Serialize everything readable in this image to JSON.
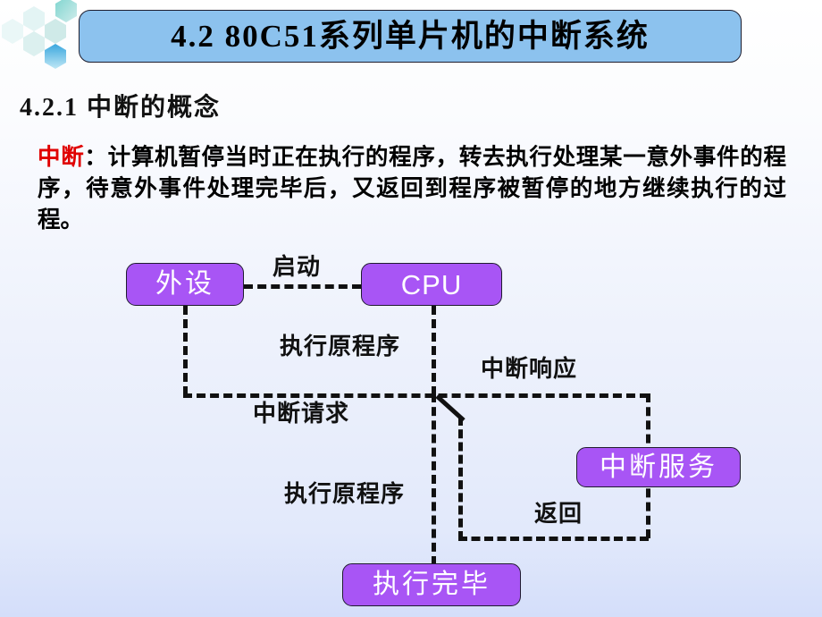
{
  "slide": {
    "background_top": "#ffffff",
    "background_bottom": "#d4defa"
  },
  "decoration": {
    "hexagon_cluster_name": "hexagon-cluster",
    "hex_colors": [
      "#e6f5f5",
      "#d8f0f0",
      "#c3e8e6",
      "#9fdcd6",
      "#6fc9d8",
      "#3aa7de"
    ]
  },
  "title": {
    "text": "4.2  80C51系列单片机的中断系统",
    "fill": "#8cc2ee",
    "border": "#1d1d2e"
  },
  "heading": {
    "text": "4.2.1 中断的概念"
  },
  "paragraph": {
    "keyword": "中断",
    "keyword_color": "#e00000",
    "colon": "：",
    "body": "计算机暂停当时正在执行的程序，转去执行处理某一意外事件的程序，待意外事件处理完毕后，又返回到程序被暂停的地方继续执行的过程。"
  },
  "diagram": {
    "node_fill": "#a855f5",
    "node_text_color": "#ffffff",
    "line_color": "#111111",
    "nodes": [
      {
        "id": "waishe",
        "label": "外设"
      },
      {
        "id": "cpu",
        "label": "CPU"
      },
      {
        "id": "service",
        "label": "中断服务"
      },
      {
        "id": "finish",
        "label": "执行完毕"
      }
    ],
    "edge_labels": [
      {
        "id": "qidong",
        "label": "启动"
      },
      {
        "id": "exec-orig-1",
        "label": "执行原程序"
      },
      {
        "id": "zhongduan-request",
        "label": "中断请求"
      },
      {
        "id": "zhongduan-response",
        "label": "中断响应"
      },
      {
        "id": "exec-orig-2",
        "label": "执行原程序"
      },
      {
        "id": "fanhui",
        "label": "返回"
      }
    ]
  }
}
